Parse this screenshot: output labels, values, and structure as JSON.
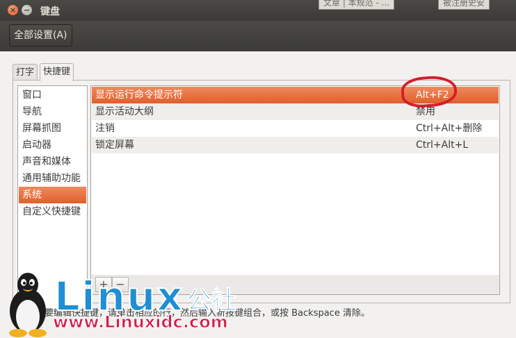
{
  "window": {
    "title": "键盘",
    "background_text_left": "文章 | 本规范 - ...",
    "background_text_right": "被注册史安"
  },
  "toolbar": {
    "all_settings_label": "全部设置(A)"
  },
  "tabs": [
    {
      "label": "打字",
      "active": false
    },
    {
      "label": "快捷键",
      "active": true
    }
  ],
  "categories": [
    {
      "label": "窗口",
      "selected": false
    },
    {
      "label": "导航",
      "selected": false
    },
    {
      "label": "屏幕抓图",
      "selected": false
    },
    {
      "label": "启动器",
      "selected": false
    },
    {
      "label": "声音和媒体",
      "selected": false
    },
    {
      "label": "通用辅助功能",
      "selected": false
    },
    {
      "label": "系统",
      "selected": true
    },
    {
      "label": "自定义快捷键",
      "selected": false
    }
  ],
  "shortcuts": [
    {
      "name": "显示运行命令提示符",
      "accel": "Alt+F2",
      "selected": true
    },
    {
      "name": "显示活动大纲",
      "accel": "禁用",
      "selected": false
    },
    {
      "name": "注销",
      "accel": "Ctrl+Alt+删除",
      "selected": false
    },
    {
      "name": "锁定屏幕",
      "accel": "Ctrl+Alt+L",
      "selected": false
    }
  ],
  "buttons": {
    "add": "+",
    "remove": "−"
  },
  "hint": "要编辑快捷键，请单击相应的行，然后输入新按键组合，或按 Backspace 清除。",
  "watermark": {
    "logo": "Linux",
    "cn": "公社",
    "url": "www.Linuxidc.com"
  },
  "colors": {
    "accent": "#e0602b",
    "annotation": "#d41f2a",
    "watermark_blue": "#1f8fd4",
    "watermark_red": "#d21f4a"
  }
}
